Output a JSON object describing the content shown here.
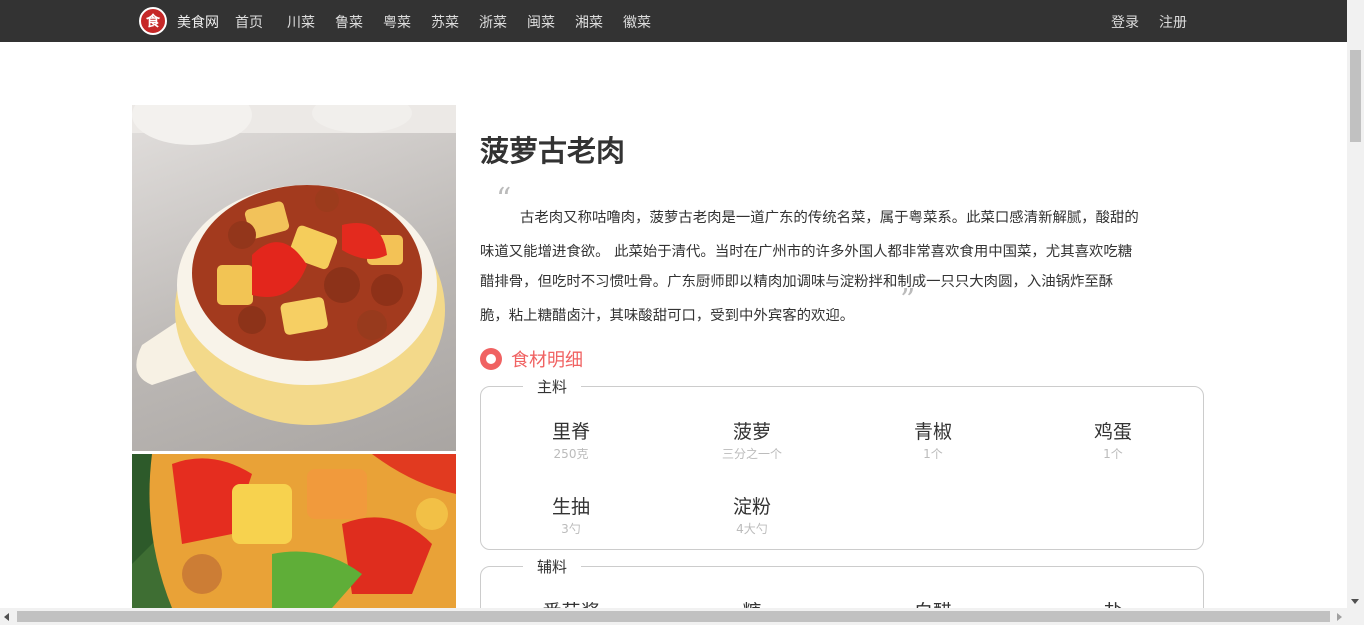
{
  "nav": {
    "brand": "美食网",
    "links": [
      "首页",
      "川菜",
      "鲁菜",
      "粤菜",
      "苏菜",
      "浙菜",
      "闽菜",
      "湘菜",
      "徽菜"
    ],
    "login": "登录",
    "register": "注册"
  },
  "recipe": {
    "title": "菠萝古老肉",
    "description_lines": [
      "古老肉又称咕噜肉，菠萝古老肉是一道广东的传统名菜，属于粤菜系。此菜口感清新解腻，酸甜的",
      "味道又能增进食欲。 此菜始于清代。当时在广州市的许多外国人都非常喜欢食用中国菜，尤其喜欢吃糖",
      "醋排骨，但吃时不习惯吐骨。广东厨师即以精肉加调味与淀粉拌和制成一只只大肉圆，入油锅炸至酥",
      "脆，粘上糖醋卤汁，其味酸甜可口，受到中外宾客的欢迎。"
    ]
  },
  "ingredients": {
    "section_title": "食材明细",
    "main": {
      "label": "主料",
      "items": [
        {
          "name": "里脊",
          "amount": "250克"
        },
        {
          "name": "菠萝",
          "amount": "三分之一个"
        },
        {
          "name": "青椒",
          "amount": "1个"
        },
        {
          "name": "鸡蛋",
          "amount": "1个"
        },
        {
          "name": "生抽",
          "amount": "3勺"
        },
        {
          "name": "淀粉",
          "amount": "4大勺"
        }
      ]
    },
    "aux": {
      "label": "辅料",
      "items": [
        {
          "name": "番茄酱"
        },
        {
          "name": "糖"
        },
        {
          "name": "白醋"
        },
        {
          "name": "盐"
        }
      ]
    }
  },
  "colors": {
    "navbar": "#333333",
    "accent": "#f06262"
  }
}
